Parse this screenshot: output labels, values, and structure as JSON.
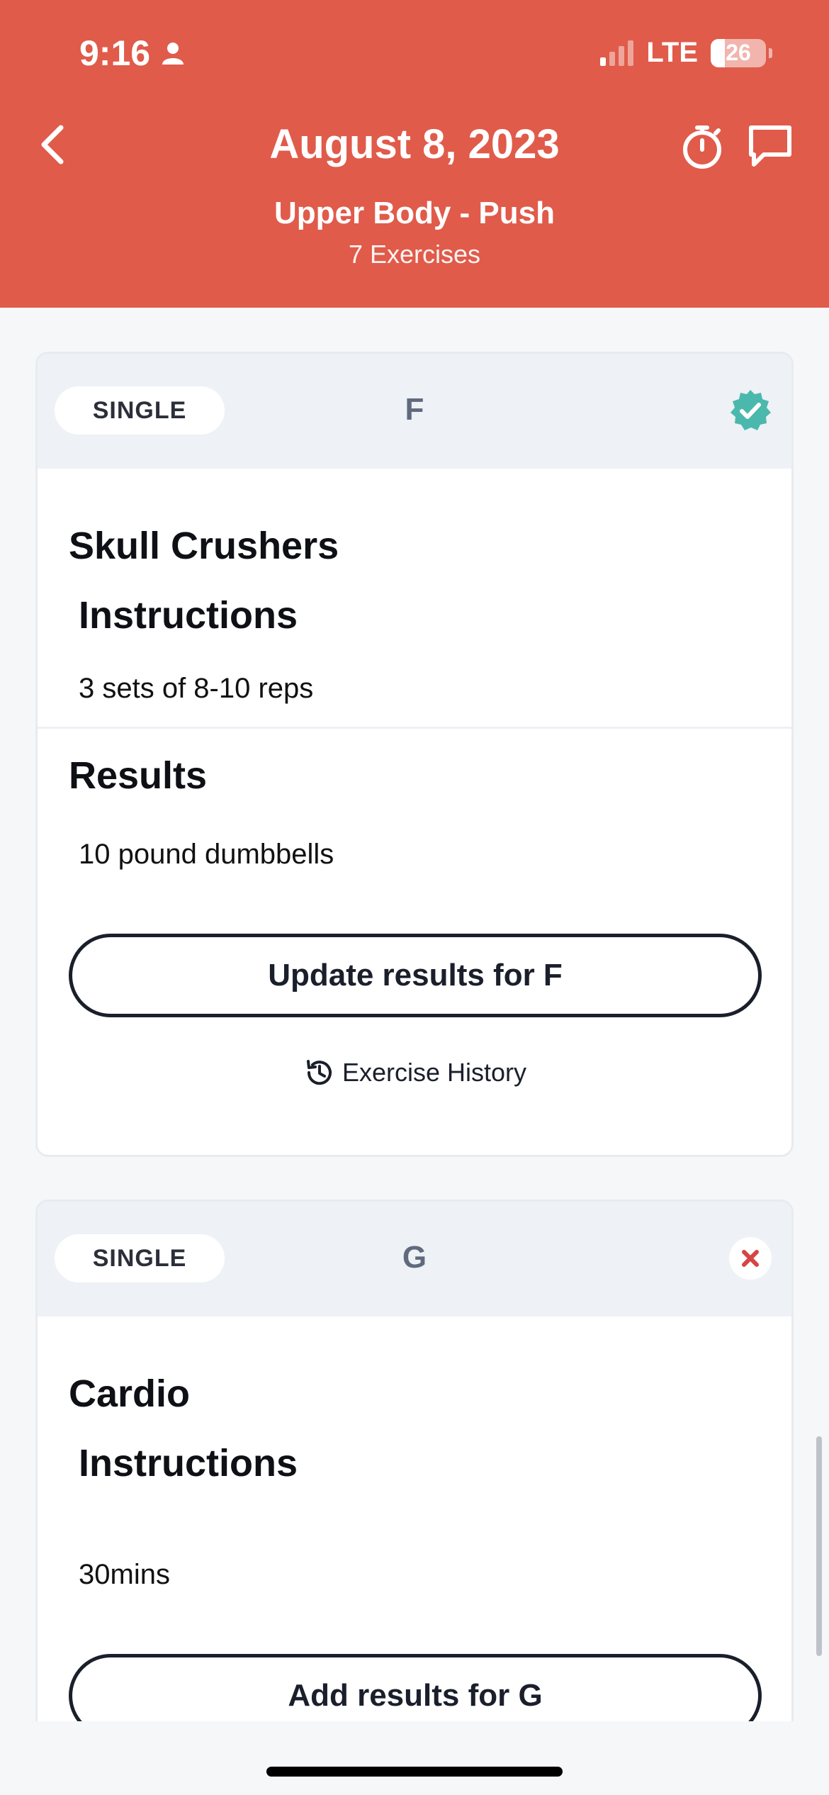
{
  "status_bar": {
    "time": "9:16",
    "network": "LTE",
    "battery": "26"
  },
  "header": {
    "title": "August 8, 2023",
    "workout_name": "Upper Body - Push",
    "exercise_count": "7 Exercises",
    "background": "#e05b4a"
  },
  "exercises": [
    {
      "type": "SINGLE",
      "letter": "F",
      "status": "completed",
      "name": "Skull Crushers",
      "instructions_label": "Instructions",
      "instructions": "3 sets of 8-10 reps",
      "results_label": "Results",
      "results": "10 pound dumbbells",
      "action_label": "Update results for F",
      "history_label": "Exercise History"
    },
    {
      "type": "SINGLE",
      "letter": "G",
      "status": "incomplete",
      "name": "Cardio",
      "instructions_label": "Instructions",
      "instructions": "30mins",
      "action_label": "Add results for G"
    }
  ],
  "icons": {
    "back": "chevron-left-icon",
    "timer": "stopwatch-icon",
    "chat": "chat-bubble-icon",
    "completed": "check-badge-icon",
    "incomplete": "close-icon",
    "history": "history-icon"
  },
  "colors": {
    "accent": "#e05b4a",
    "success": "#4bb8ad",
    "danger": "#d64545"
  }
}
